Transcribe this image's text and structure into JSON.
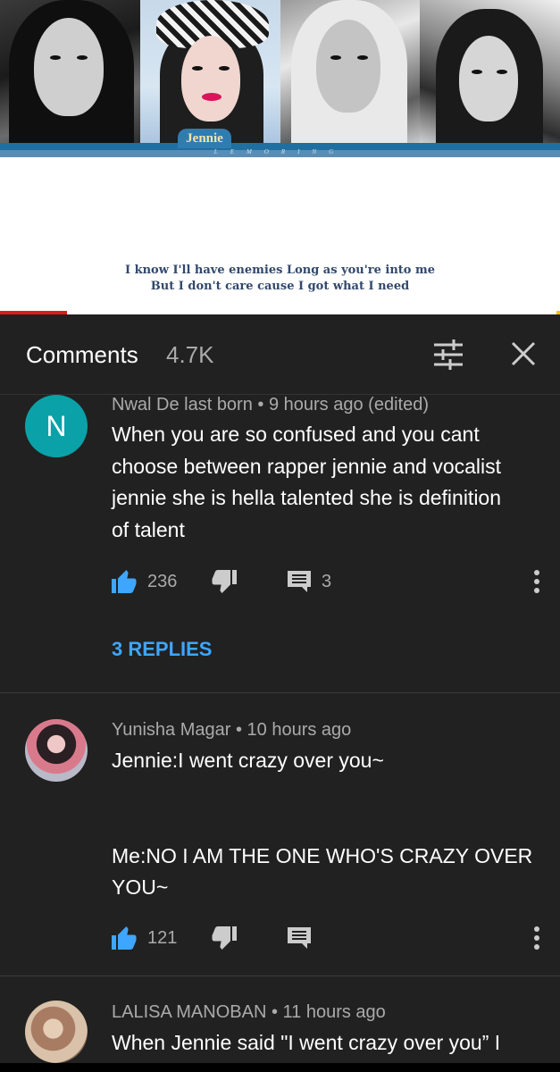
{
  "video": {
    "name_tag": "Jennie",
    "brand": "LEMORING",
    "lyric_line1": "I know I'll have enemies Long as you're into me",
    "lyric_line2": "But I don't care cause I got what I need",
    "progress_fraction": 0.12,
    "colors": {
      "progress": "#e01b1b",
      "name_bar": "#1f6fa1"
    }
  },
  "header": {
    "title": "Comments",
    "count": "4.7K",
    "filter_icon": "sort-filter-icon",
    "close_icon": "close-icon"
  },
  "comments": [
    {
      "avatar_letter": "N",
      "author": "Nwal De last born",
      "time": "9 hours ago (edited)",
      "lines": [
        "When you are so confused and you cant",
        "choose between rapper jennie and vocalist",
        "jennie she is hella talented she is definition",
        "of talent"
      ],
      "likes": "236",
      "reply_count": "3",
      "replies_label": "3 REPLIES"
    },
    {
      "author": "Yunisha Magar",
      "time": "10 hours ago",
      "lines": [
        "Jennie:I went crazy over you~",
        "",
        "",
        "Me:NO I AM THE ONE WHO'S CRAZY OVER",
        "YOU~"
      ],
      "likes": "121"
    },
    {
      "author": "LALISA MANOBAN",
      "time": "11 hours ago",
      "lines": [
        "When Jennie said \"I went crazy over you” I"
      ]
    }
  ],
  "separator": " • ",
  "colors": {
    "background": "#212121",
    "link": "#3ea6ff",
    "like_active": "#3ea6ff",
    "avatar_n": "#0aa2a8"
  }
}
